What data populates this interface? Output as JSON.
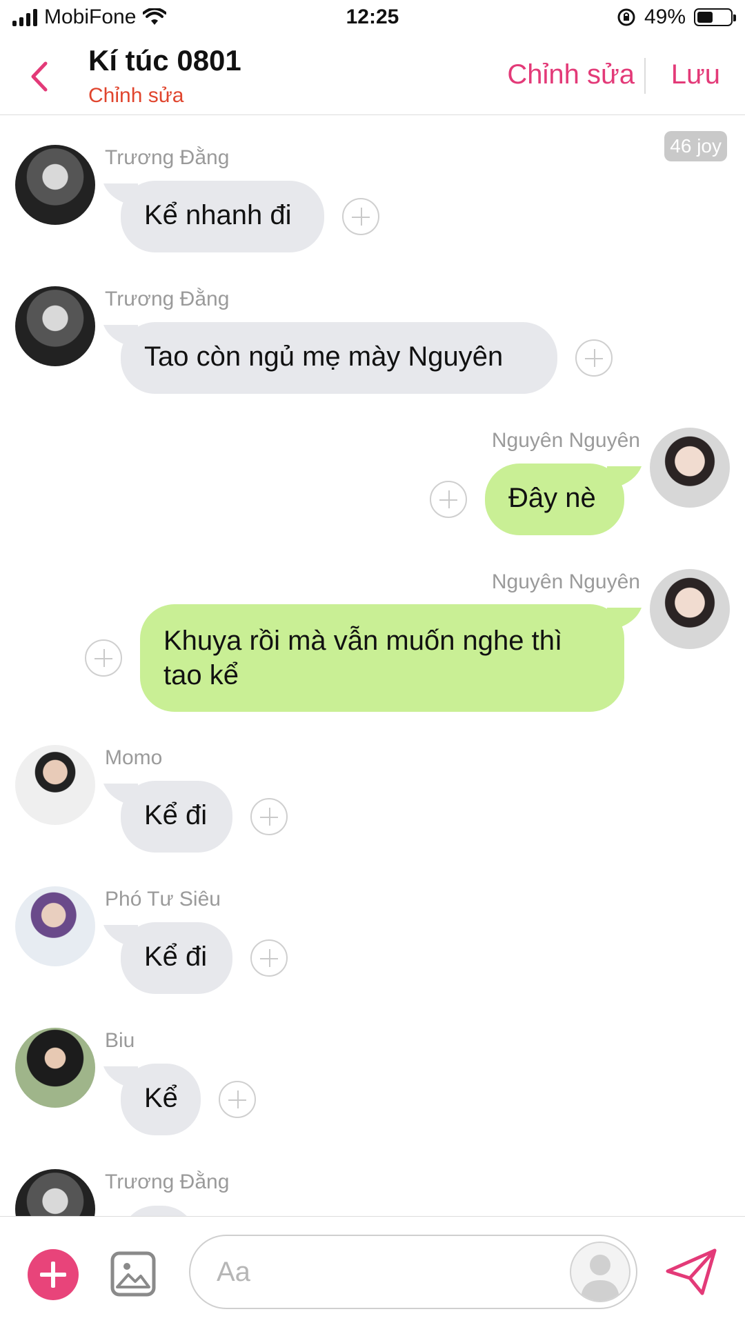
{
  "status_bar": {
    "carrier": "MobiFone",
    "time": "12:25",
    "battery": "49%",
    "battery_level": 0.49
  },
  "header": {
    "title": "Kí túc 0801",
    "subtitle": "Chỉnh sửa",
    "edit_label": "Chỉnh sửa",
    "save_label": "Lưu"
  },
  "joy_badge": "46 joy",
  "messages": [
    {
      "sender": "Trương Đằng",
      "text": "Kể nhanh đi"
    },
    {
      "sender": "Trương Đằng",
      "text": "Tao còn ngủ mẹ mày Nguyên"
    },
    {
      "sender": "Nguyên Nguyên",
      "text": "Đây nè"
    },
    {
      "sender": "Nguyên Nguyên",
      "text": "Khuya rồi mà vẫn muốn nghe thì tao kể"
    },
    {
      "sender": "Momo",
      "text": "Kể đi"
    },
    {
      "sender": "Phó Tư Siêu",
      "text": "Kể đi"
    },
    {
      "sender": "Biu",
      "text": "Kể"
    },
    {
      "sender": "Trương Đằng",
      "text": ""
    }
  ],
  "composer": {
    "placeholder": "Aa"
  },
  "colors": {
    "accent": "#e33a78",
    "subtitle": "#e0452e",
    "incoming_bubble": "#e7e8ec",
    "outgoing_bubble": "#c9ef95"
  }
}
